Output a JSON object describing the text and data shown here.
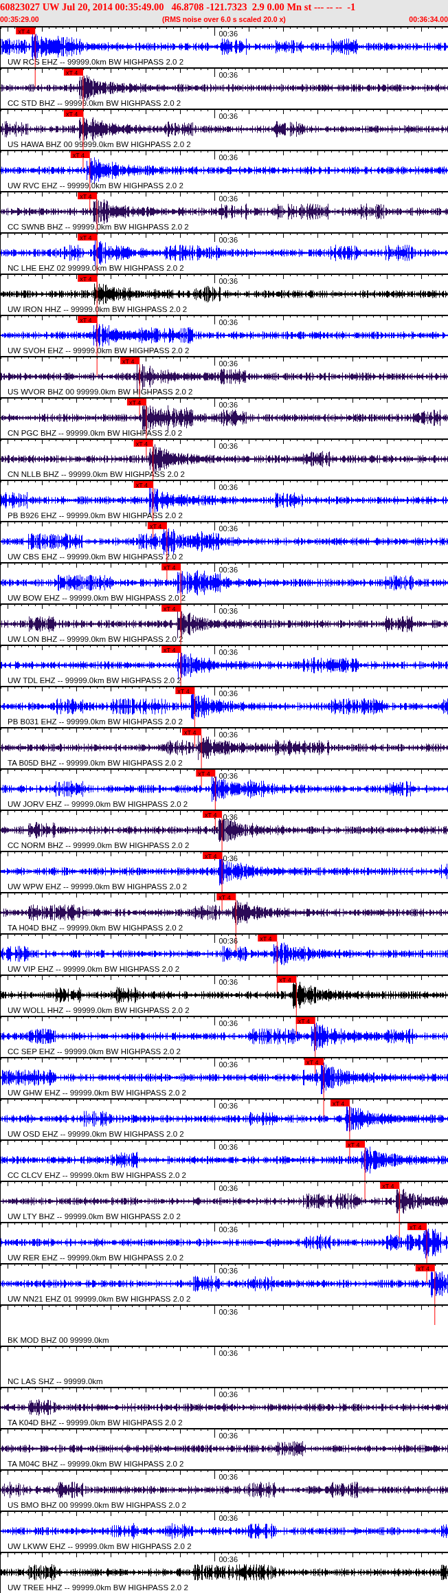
{
  "header": {
    "title": "60823027 UW Jul 20, 2014 00:35:49.00   46.8708 -121.7323  2.9 0.00 Mn st --- -- --  -1",
    "start_time": "00:35:29.00",
    "note": "(RMS noise over 6.0 s scaled 20.0 x)",
    "end_time": "00:36:34.00"
  },
  "traces": [
    {
      "kind": "waveform",
      "color": "#0000ff",
      "label": "UW RCS EHZ -- 99999.0km BW HIGHPASS 2.0 2",
      "time_mark": "00:36",
      "pick": {
        "label": "xT 4",
        "level": 0.077
      }
    },
    {
      "kind": "waveform",
      "color": "#2b0a57",
      "label": "CC STD BHZ -- 99999.0km BW HIGHPASS 2.0 2",
      "time_mark": "00:36",
      "pick": {
        "label": "xT 4",
        "level": 0.184
      }
    },
    {
      "kind": "waveform",
      "color": "#2b0a57",
      "label": "US HAWA BHZ 00 99999.0km BW HIGHPASS 2.0 2",
      "time_mark": "00:36",
      "pick": {
        "label": "xT 4",
        "level": 0.184
      }
    },
    {
      "kind": "waveform",
      "color": "#0000ff",
      "label": "UW RVC EHZ -- 99999.0km BW HIGHPASS 2.0 2",
      "time_mark": "00:36",
      "pick": {
        "label": "xT 4",
        "level": 0.199
      }
    },
    {
      "kind": "waveform",
      "color": "#2b0a57",
      "label": "CC SWNB BHZ -- 99999.0km BW HIGHPASS 2.0 2",
      "time_mark": "00:36",
      "pick": {
        "label": "xT 4",
        "level": 0.215
      }
    },
    {
      "kind": "waveform",
      "color": "#0000ff",
      "label": "NC LHE EHZ 02 99999.0km BW HIGHPASS 2.0 2",
      "time_mark": "00:36",
      "pick": {
        "label": "xT 4",
        "level": 0.215
      }
    },
    {
      "kind": "waveform",
      "color": "#000000",
      "label": "UW IRON HHZ -- 99999.0km BW HIGHPASS 2.0 2",
      "time_mark": "00:36",
      "pick": {
        "label": "xT 4",
        "level": 0.215
      }
    },
    {
      "kind": "waveform",
      "color": "#0000ff",
      "label": "UW SVOH EHZ -- 99999.0km BW HIGHPASS 2.0 2",
      "time_mark": "00:36",
      "pick": {
        "label": "xT 4",
        "level": 0.215
      }
    },
    {
      "kind": "waveform",
      "color": "#2b0a57",
      "label": "US WVOR BHZ 00 99999.0km BW HIGHPASS 2.0 2",
      "time_mark": "00:36",
      "pick": {
        "label": "xT 4",
        "level": 0.31
      }
    },
    {
      "kind": "waveform",
      "color": "#2b0a57",
      "label": "CN PGC BHZ -- 99999.0km BW HIGHPASS 2.0 2",
      "time_mark": "00:36",
      "pick": {
        "label": "xT 4",
        "level": 0.325
      }
    },
    {
      "kind": "waveform",
      "color": "#2b0a57",
      "label": "CN NLLB BHZ -- 99999.0km BW HIGHPASS 2.0 2",
      "time_mark": "00:36",
      "pick": {
        "label": "xT 4",
        "level": 0.34
      }
    },
    {
      "kind": "waveform",
      "color": "#0000ff",
      "label": "PB B926 EHZ -- 99999.0km BW HIGHPASS 2.0 2",
      "time_mark": "00:36",
      "pick": {
        "label": "xT 4",
        "level": 0.34
      }
    },
    {
      "kind": "waveform",
      "color": "#0000ff",
      "label": "UW CBS EHZ -- 99999.0km BW HIGHPASS 2.0 2",
      "time_mark": "00:36",
      "pick": {
        "label": "xT 4",
        "level": 0.371
      }
    },
    {
      "kind": "waveform",
      "color": "#0000ff",
      "label": "UW BOW EHZ -- 99999.0km BW HIGHPASS 2.0 2",
      "time_mark": "00:36",
      "pick": {
        "label": "xT 4",
        "level": 0.402
      }
    },
    {
      "kind": "waveform",
      "color": "#2b0a57",
      "label": "UW LON BHZ -- 99999.0km BW HIGHPASS 2.0 2",
      "time_mark": "00:36",
      "pick": {
        "label": "xT 4",
        "level": 0.402
      }
    },
    {
      "kind": "waveform",
      "color": "#0000ff",
      "label": "UW TDL EHZ -- 99999.0km BW HIGHPASS 2.0 2",
      "time_mark": "00:36",
      "pick": {
        "label": "xT 4",
        "level": 0.402
      }
    },
    {
      "kind": "waveform",
      "color": "#0000ff",
      "label": "PB B031 EHZ -- 99999.0km BW HIGHPASS 2.0 2",
      "time_mark": "00:36",
      "pick": {
        "label": "xT 4",
        "level": 0.433
      }
    },
    {
      "kind": "waveform",
      "color": "#2b0a57",
      "label": "TA B05D BHZ -- 99999.0km BW HIGHPASS 2.0 2",
      "time_mark": "00:36",
      "pick": {
        "label": "xT 4",
        "level": 0.448
      }
    },
    {
      "kind": "waveform",
      "color": "#0000ff",
      "label": "UW JORV EHZ -- 99999.0km BW HIGHPASS 2.0 2",
      "time_mark": "00:36",
      "pick": {
        "label": "xT 4",
        "level": 0.479
      }
    },
    {
      "kind": "waveform",
      "color": "#2b0a57",
      "label": "CC NORM BHZ -- 99999.0km BW HIGHPASS 2.0 2",
      "time_mark": "0:36",
      "pick": {
        "label": "xT 4",
        "level": 0.494
      }
    },
    {
      "kind": "waveform",
      "color": "#0000ff",
      "label": "UW WPW EHZ -- 99999.0km BW HIGHPASS 2.0 2",
      "time_mark": "0:36",
      "pick": {
        "label": "xT 4",
        "level": 0.494
      }
    },
    {
      "kind": "waveform",
      "color": "#2b0a57",
      "label": "TA H04D BHZ -- 99999.0km BW HIGHPASS 2.0 2",
      "pick": {
        "label": "xT 4",
        "level": 0.525
      }
    },
    {
      "kind": "waveform",
      "color": "#0000ff",
      "label": "UW VIP EHZ -- 99999.0km BW HIGHPASS 2.0 2",
      "time_mark": "00:36",
      "pick": {
        "label": "xT 4",
        "level": 0.617
      }
    },
    {
      "kind": "waveform",
      "color": "#000000",
      "label": "UW WOLL HHZ -- 99999.0km BW HIGHPASS 2.0 2",
      "time_mark": "00:36",
      "pick": {
        "label": "xT 4",
        "level": 0.66
      }
    },
    {
      "kind": "waveform",
      "color": "#0000ff",
      "label": "CC SEP EHZ -- 99999.0km BW HIGHPASS 2.0 2",
      "time_mark": "00:36",
      "pick": {
        "label": "xT 4",
        "level": 0.702
      }
    },
    {
      "kind": "waveform",
      "color": "#0000ff",
      "label": "UW GHW EHZ -- 99999.0km BW HIGHPASS 2.0 2",
      "time_mark": "00:36",
      "pick": {
        "label": "xT 4",
        "level": 0.721
      }
    },
    {
      "kind": "waveform",
      "color": "#0000ff",
      "label": "UW OSD EHZ -- 99999.0km BW HIGHPASS 2.0 2",
      "time_mark": "00:36",
      "pick": {
        "label": "xT 4",
        "level": 0.779
      }
    },
    {
      "kind": "waveform",
      "color": "#0000ff",
      "label": "CC CLCV EHZ -- 99999.0km BW HIGHPASS 2.0 2",
      "time_mark": "00:36",
      "pick": {
        "label": "xT 4",
        "level": 0.813
      }
    },
    {
      "kind": "waveform",
      "color": "#2b0a57",
      "label": "UW LTY BHZ -- 99999.0km BW HIGHPASS 2.0 2",
      "time_mark": "00:36",
      "pick": {
        "label": "xT 4",
        "level": 0.89
      }
    },
    {
      "kind": "waveform",
      "color": "#0000ff",
      "label": "UW RER EHZ -- 99999.0km BW HIGHPASS 2.0 2",
      "time_mark": "00:36",
      "pick": {
        "label": "xT 4",
        "level": 0.951
      }
    },
    {
      "kind": "waveform",
      "color": "#0000ff",
      "label": "UW NN21 EHZ 01 99999.0km BW HIGHPASS 2.0 2",
      "time_mark": "00:36",
      "pick": {
        "label": "xT 4",
        "level": 0.969
      }
    },
    {
      "kind": "empty",
      "label": "BK MOD BHZ 00 99999.0km",
      "time_mark": "00:36"
    },
    {
      "kind": "empty",
      "label": "NC LAS SHZ -- 99999.0km",
      "time_mark": "00:36"
    },
    {
      "kind": "waveform",
      "color": "#2b0a57",
      "label": "TA K04D BHZ -- 99999.0km BW HIGHPASS 2.0 2",
      "time_mark": "00:36"
    },
    {
      "kind": "waveform",
      "color": "#2b0a57",
      "label": "TA M04C BHZ -- 99999.0km BW HIGHPASS 2.0 2",
      "time_mark": "00:36"
    },
    {
      "kind": "waveform",
      "color": "#2b0a57",
      "label": "US BMO BHZ 00 99999.0km BW HIGHPASS 2.0 2",
      "time_mark": "00:36"
    },
    {
      "kind": "waveform",
      "color": "#0000ff",
      "label": "UW LKWW EHZ -- 99999.0km BW HIGHPASS 2.0 2",
      "time_mark": "00:36"
    },
    {
      "kind": "waveform",
      "color": "#000000",
      "label": "UW TREE HHZ -- 99999.0km BW HIGHPASS 2.0 2",
      "time_mark": "00:36"
    }
  ]
}
